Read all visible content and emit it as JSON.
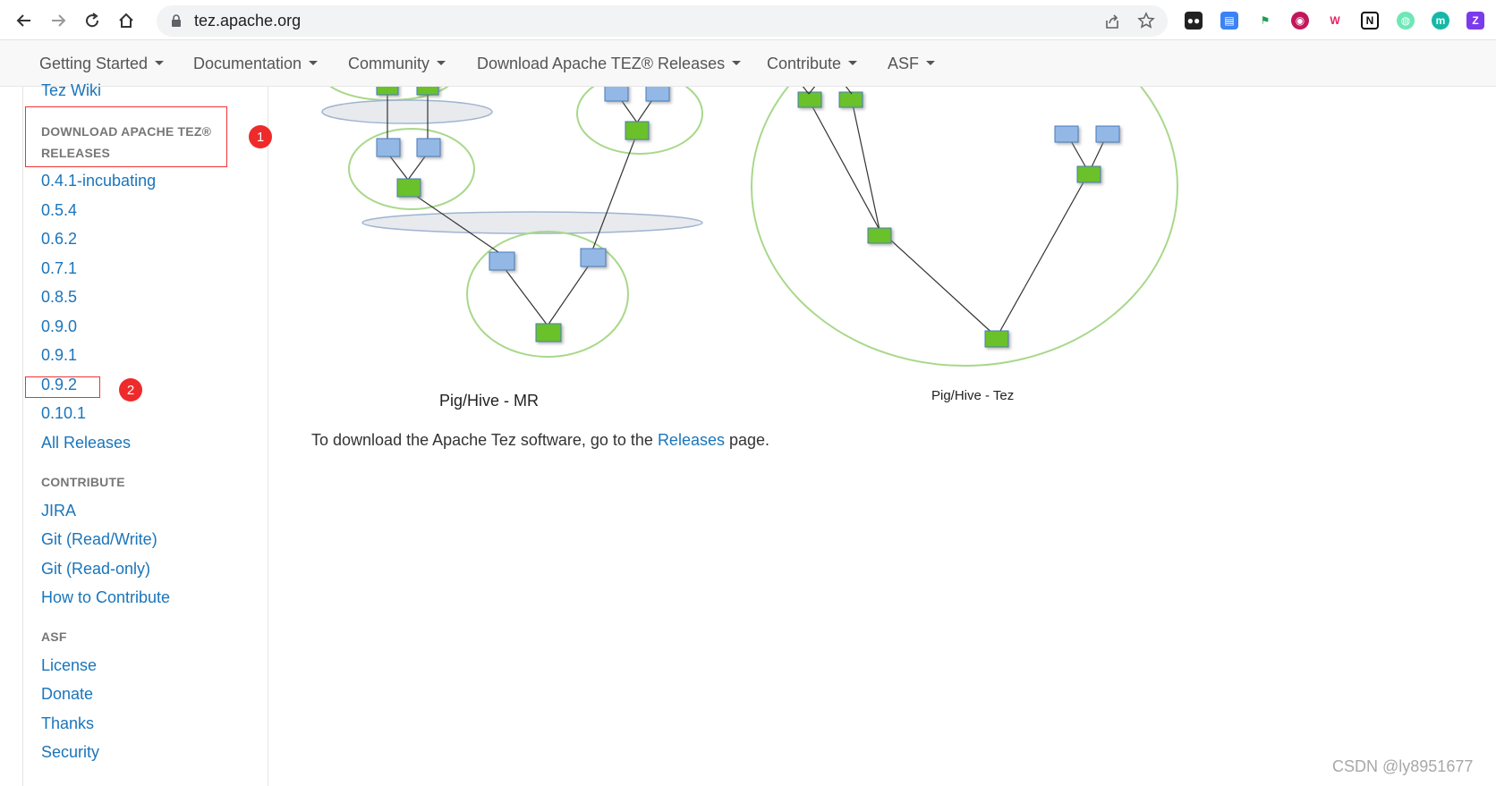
{
  "browser": {
    "url": "tez.apache.org"
  },
  "nav": {
    "items": [
      {
        "label": "Getting Started"
      },
      {
        "label": "Documentation"
      },
      {
        "label": "Community"
      },
      {
        "label": "Download Apache TEZ® Releases"
      },
      {
        "label": "Contribute"
      },
      {
        "label": "ASF"
      }
    ]
  },
  "sidebar": {
    "top_link": "Tez Wiki",
    "download_heading": "DOWNLOAD APACHE TEZ®",
    "download_heading_line2": "RELEASES",
    "releases": [
      "0.4.1-incubating",
      "0.5.4",
      "0.6.2",
      "0.7.1",
      "0.8.5",
      "0.9.0",
      "0.9.1",
      "0.9.2",
      "0.10.1",
      "All Releases"
    ],
    "contribute_heading": "CONTRIBUTE",
    "contribute_links": [
      "JIRA",
      "Git (Read/Write)",
      "Git (Read-only)",
      "How to Contribute"
    ],
    "asf_heading": "ASF",
    "asf_links": [
      "License",
      "Donate",
      "Thanks",
      "Security"
    ]
  },
  "annotations": {
    "badge1": "1",
    "badge2": "2"
  },
  "main": {
    "caption_mr": "Pig/Hive - MR",
    "caption_tez": "Pig/Hive - Tez",
    "download_prefix": "To download the Apache Tez software, go to the ",
    "download_link": "Releases",
    "download_suffix": " page."
  },
  "watermark": "CSDN @ly8951677",
  "colors": {
    "link": "#1a75bb",
    "annotation": "#ee2a2a",
    "node_blue": "#94b8e6",
    "node_green": "#6ac12a",
    "circle": "#a8d88a"
  }
}
